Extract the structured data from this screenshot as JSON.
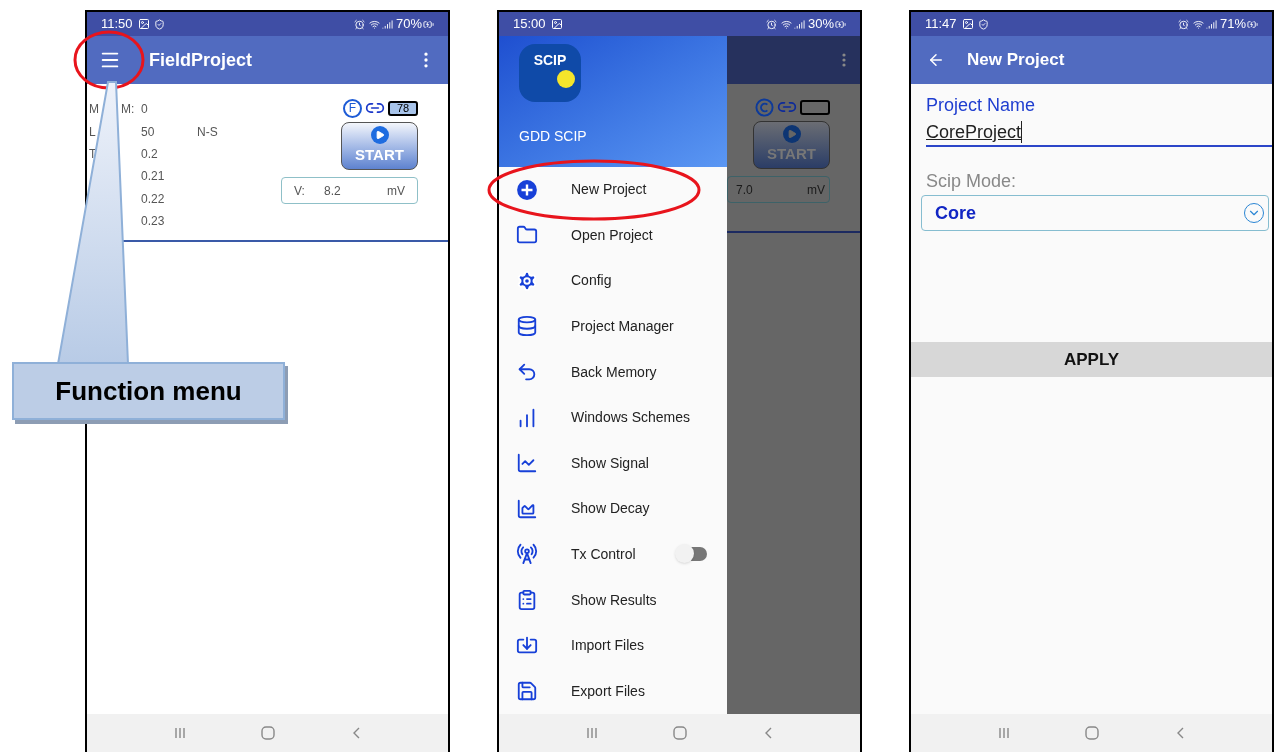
{
  "callout": {
    "text": "Function menu"
  },
  "phones": [
    {
      "kind": "main",
      "status_bar": {
        "time": "11:50",
        "battery": "70%"
      },
      "app_bar": {
        "title": "FieldProject",
        "menu_highlighted": true
      },
      "readings": [
        {
          "label": [
            "M",
            "M:"
          ],
          "value": "0"
        },
        {
          "label": [
            "L"
          ],
          "value": "50",
          "extra": "N-S"
        },
        {
          "label": [
            "T"
          ],
          "value": "0.2"
        },
        {
          "value": "0.21"
        },
        {
          "value": "0.22"
        },
        {
          "value": "0.23"
        }
      ],
      "device": {
        "mode": "F",
        "battery": "78"
      },
      "start_button": "START",
      "voltage": {
        "label": "V:",
        "value": "8.2",
        "unit": "mV"
      }
    },
    {
      "kind": "drawer",
      "status_bar": {
        "time": "15:00",
        "battery": "30%"
      },
      "drawer": {
        "logo": "SCIP",
        "subtitle": "GDD SCIP",
        "items": [
          {
            "kind": "link",
            "label": "New Project",
            "highlighted": true
          },
          {
            "kind": "link",
            "label": "Open Project",
            "highlighted": false
          },
          {
            "kind": "link",
            "label": "Config",
            "highlighted": false
          },
          {
            "kind": "link",
            "label": "Project Manager",
            "highlighted": false
          },
          {
            "kind": "link",
            "label": "Back Memory",
            "highlighted": false
          },
          {
            "kind": "link",
            "label": "Windows Schemes",
            "highlighted": false
          },
          {
            "kind": "link",
            "label": "Show Signal",
            "highlighted": false
          },
          {
            "kind": "link",
            "label": "Show Decay",
            "highlighted": false
          },
          {
            "kind": "toggle",
            "label": "Tx Control",
            "highlighted": false,
            "on": false
          },
          {
            "kind": "link",
            "label": "Show Results",
            "highlighted": false
          },
          {
            "kind": "link",
            "label": "Import Files",
            "highlighted": false
          },
          {
            "kind": "link",
            "label": "Export Files",
            "highlighted": false
          }
        ]
      },
      "start_button": "START",
      "voltage": {
        "value": "7.0",
        "unit": "mV"
      }
    },
    {
      "kind": "form",
      "status_bar": {
        "time": "11:47",
        "battery": "71%"
      },
      "app_bar": {
        "title": "New Project"
      },
      "name_field": {
        "label": "Project Name",
        "value": "CoreProject"
      },
      "mode_field": {
        "label": "Scip Mode:",
        "value": "Core"
      },
      "apply_button": "APPLY"
    }
  ]
}
